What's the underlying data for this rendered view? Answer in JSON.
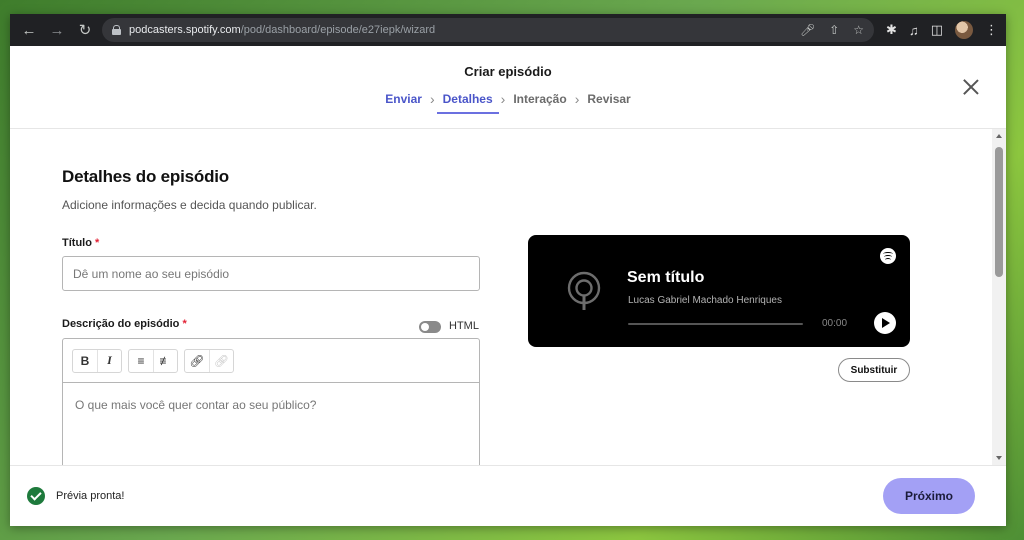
{
  "browser": {
    "url_host": "podcasters.spotify.com",
    "url_path": "/pod/dashboard/episode/e27iepk/wizard"
  },
  "header": {
    "title": "Criar episódio",
    "steps": [
      {
        "label": "Enviar",
        "state": "done"
      },
      {
        "label": "Detalhes",
        "state": "active"
      },
      {
        "label": "Interação",
        "state": "todo"
      },
      {
        "label": "Revisar",
        "state": "todo"
      }
    ],
    "step_separator": "›"
  },
  "form": {
    "heading": "Detalhes do episódio",
    "subheading": "Adicione informações e decida quando publicar.",
    "title_label": "Título",
    "title_placeholder": "Dê um nome ao seu episódio",
    "required_mark": "*",
    "description_label": "Descrição do episódio",
    "html_toggle_label": "HTML",
    "html_toggle_on": false,
    "editor_toolbar": {
      "bold": "B",
      "italic": "I"
    },
    "description_placeholder": "O que mais você quer contar ao seu público?"
  },
  "preview": {
    "title": "Sem título",
    "author": "Lucas Gabriel Machado Henriques",
    "time": "00:00",
    "progress": 0,
    "replace_label": "Substituir"
  },
  "footer": {
    "status": "Prévia pronta!",
    "next_label": "Próximo"
  },
  "colors": {
    "accent": "#4a55c9",
    "next_button": "#a3a0f5",
    "success": "#1e7a3c",
    "required": "#e22134"
  }
}
